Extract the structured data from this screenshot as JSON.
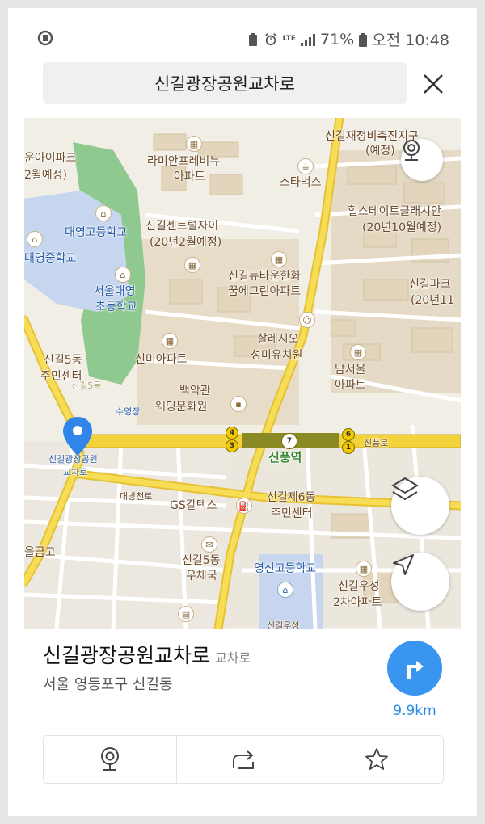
{
  "status_bar": {
    "battery": "71%",
    "time": "오전 10:48",
    "network": "LTE"
  },
  "header": {
    "search_value": "신길광장공원교차로"
  },
  "map": {
    "labels": {
      "l1": "라미안프레비뉴",
      "l2": "아파트",
      "l3": "스타벅스",
      "l4": "신길재정비촉진지구",
      "l5": "(예정)",
      "l6": "힐스테이트클래시안",
      "l7": "(20년10월예정)",
      "l8": "대영고등학교",
      "l9": "대영중학교",
      "l10": "신길센트럴자이",
      "l11": "(20년2월예정)",
      "l12": "서울대영",
      "l13": "초등학교",
      "l14": "신길뉴타운한화",
      "l15": "꿈에그린아파트",
      "l16": "신길파크",
      "l17": "(20년11",
      "l18": "살레시오",
      "l19": "성미유치원",
      "l20": "신길5동",
      "l21": "주민센터",
      "l22": "신미아파트",
      "l23": "남서울",
      "l24": "아파트",
      "l25": "백악관",
      "l26": "웨딩문화원",
      "l27": "수영장",
      "l28": "신길광장공원",
      "l29": "교차로",
      "l30": "대방천로",
      "l31": "신풍역",
      "l32": "신풍로",
      "l33": "GS칼텍스",
      "l34": "신길제6동",
      "l35": "주민센터",
      "l36": "신길5동",
      "l37": "우체국",
      "l38": "영신고등학교",
      "l39": "신길우성",
      "l40": "2차아파트",
      "l41": "을금고",
      "l42": "운아이파크",
      "l43": "2월예정)",
      "l44": "신길5동",
      "l45": "신길우성"
    },
    "stations": [
      "4",
      "3",
      "7",
      "6",
      "1"
    ]
  },
  "place": {
    "name": "신길광장공원교차로",
    "type": "교차로",
    "address": "서울 영등포구 신길동",
    "distance": "9.9km"
  },
  "colors": {
    "accent": "#3a95f0",
    "road_major": "#f5d23a",
    "park": "#8fc98f",
    "school": "#c5d6ee"
  },
  "icons": {
    "cctv": "cctv-icon",
    "layers": "layers-icon",
    "location": "navigation-arrow-icon",
    "directions": "turn-right-icon",
    "share": "share-icon",
    "favorite": "star-icon",
    "close": "close-icon"
  }
}
